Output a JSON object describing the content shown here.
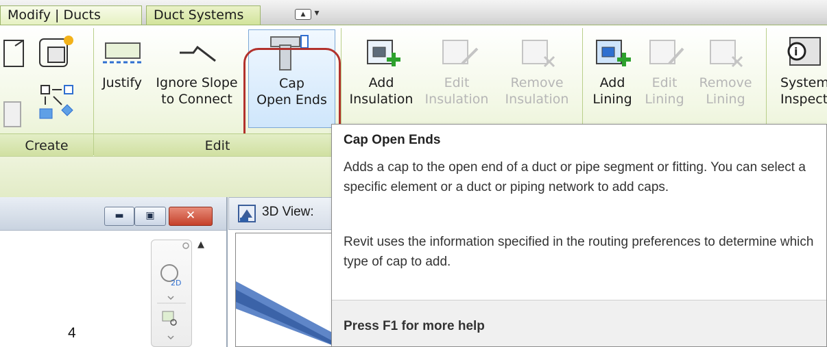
{
  "tabs": {
    "modify": "Modify | Ducts",
    "duct_systems": "Duct Systems"
  },
  "ribbon": {
    "buttons": {
      "justify": "Justify",
      "ignore_slope_1": "Ignore Slope",
      "ignore_slope_2": "to Connect",
      "cap_1": "Cap",
      "cap_2": "Open Ends",
      "add_insulation_1": "Add",
      "add_insulation_2": "Insulation",
      "edit_insulation_1": "Edit",
      "edit_insulation_2": "Insulation",
      "remove_insulation_1": "Remove",
      "remove_insulation_2": "Insulation",
      "add_lining_1": "Add",
      "add_lining_2": "Lining",
      "edit_lining_1": "Edit",
      "edit_lining_2": "Lining",
      "remove_lining_1": "Remove",
      "remove_lining_2": "Lining",
      "system_inspector_1": "System",
      "system_inspector_2": "Inspector"
    },
    "panels": {
      "create": "Create",
      "edit": "Edit"
    }
  },
  "view": {
    "title": "3D View:"
  },
  "page_number": "4",
  "tooltip": {
    "title": "Cap Open Ends",
    "description_1": "Adds a cap to the open end of a duct or pipe segment or fitting. You can select a specific element or a duct or piping network to add caps.",
    "description_2": "Revit uses the information specified in the routing preferences to determine which type of cap to add.",
    "help": "Press F1 for more help"
  },
  "colors": {
    "highlight": "#b2312c",
    "ribbon_green": "#e7f0cf",
    "add_green": "#2da12d"
  }
}
